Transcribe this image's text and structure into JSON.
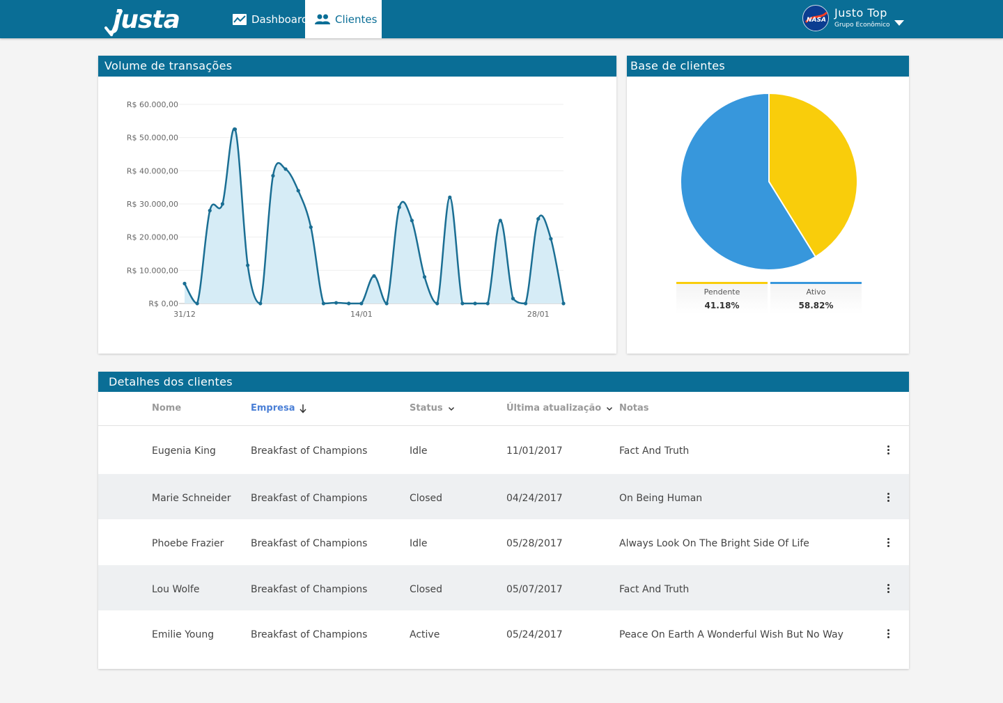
{
  "app": {
    "logo_text": "justa",
    "nav": {
      "dashboard": "Dashboard",
      "clientes": "Clientes"
    },
    "user": {
      "name": "Justo Top",
      "subtitle": "Grupo Econômico",
      "avatar_text": "NASA"
    }
  },
  "colors": {
    "brand": "#0a6e96",
    "line": "#1a6e93",
    "area": "#d6ecf6",
    "pendente": "#f9cd0b",
    "ativo": "#3797dc",
    "sorted_header": "#4a7fd6"
  },
  "volume": {
    "title": "Volume de transações"
  },
  "base": {
    "title": "Base de clientes"
  },
  "chart_data": [
    {
      "type": "area",
      "title": "Volume de transações",
      "y_ticks": [
        "R$ 0,00",
        "R$ 10.000,00",
        "R$ 20.000,00",
        "R$ 30.000,00",
        "R$ 40.000,00",
        "R$ 50.000,00",
        "R$ 60.000,00"
      ],
      "x_ticks": [
        {
          "day": 0,
          "label": "31/12"
        },
        {
          "day": 14,
          "label": "14/01"
        },
        {
          "day": 28,
          "label": "28/01"
        }
      ],
      "ylim": [
        0,
        60000
      ],
      "xlim": [
        0,
        30
      ],
      "grid": true,
      "series": [
        {
          "x": [
            0,
            1,
            2,
            3,
            4,
            5,
            6,
            7,
            8,
            9,
            10,
            11,
            12,
            13,
            14,
            15,
            16,
            17,
            18,
            19,
            20,
            21,
            22,
            23,
            24,
            25,
            26,
            27,
            28,
            29,
            30
          ],
          "values": [
            6000,
            0,
            28000,
            30000,
            52500,
            11500,
            0,
            38500,
            40500,
            34000,
            23000,
            0,
            200,
            0,
            0,
            8300,
            0,
            29000,
            25000,
            8000,
            0,
            32000,
            0,
            0,
            0,
            25000,
            1500,
            0,
            25500,
            19500,
            0
          ]
        }
      ]
    },
    {
      "type": "pie",
      "title": "Base de clientes",
      "categories": [
        "Pendente",
        "Ativo"
      ],
      "values": [
        41.18,
        58.82
      ],
      "value_labels": [
        "41.18%",
        "58.82%"
      ]
    }
  ],
  "detalhes": {
    "title": "Detalhes dos clientes",
    "columns": {
      "nome": "Nome",
      "empresa": "Empresa",
      "status": "Status",
      "data": "Última atualização",
      "notas": "Notas"
    },
    "rows": [
      {
        "nome": "Eugenia King",
        "empresa": "Breakfast of Champions",
        "status": "Idle",
        "data": "11/01/2017",
        "notas": "Fact And Truth"
      },
      {
        "nome": "Marie Schneider",
        "empresa": "Breakfast of Champions",
        "status": "Closed",
        "data": "04/24/2017",
        "notas": "On Being Human"
      },
      {
        "nome": "Phoebe Frazier",
        "empresa": "Breakfast of Champions",
        "status": "Idle",
        "data": "05/28/2017",
        "notas": "Always Look On The Bright Side Of Life"
      },
      {
        "nome": "Lou Wolfe",
        "empresa": "Breakfast of Champions",
        "status": "Closed",
        "data": "05/07/2017",
        "notas": "Fact And Truth"
      },
      {
        "nome": "Emilie Young",
        "empresa": "Breakfast of Champions",
        "status": "Active",
        "data": "05/24/2017",
        "notas": "Peace On Earth A Wonderful Wish But No Way"
      }
    ]
  }
}
